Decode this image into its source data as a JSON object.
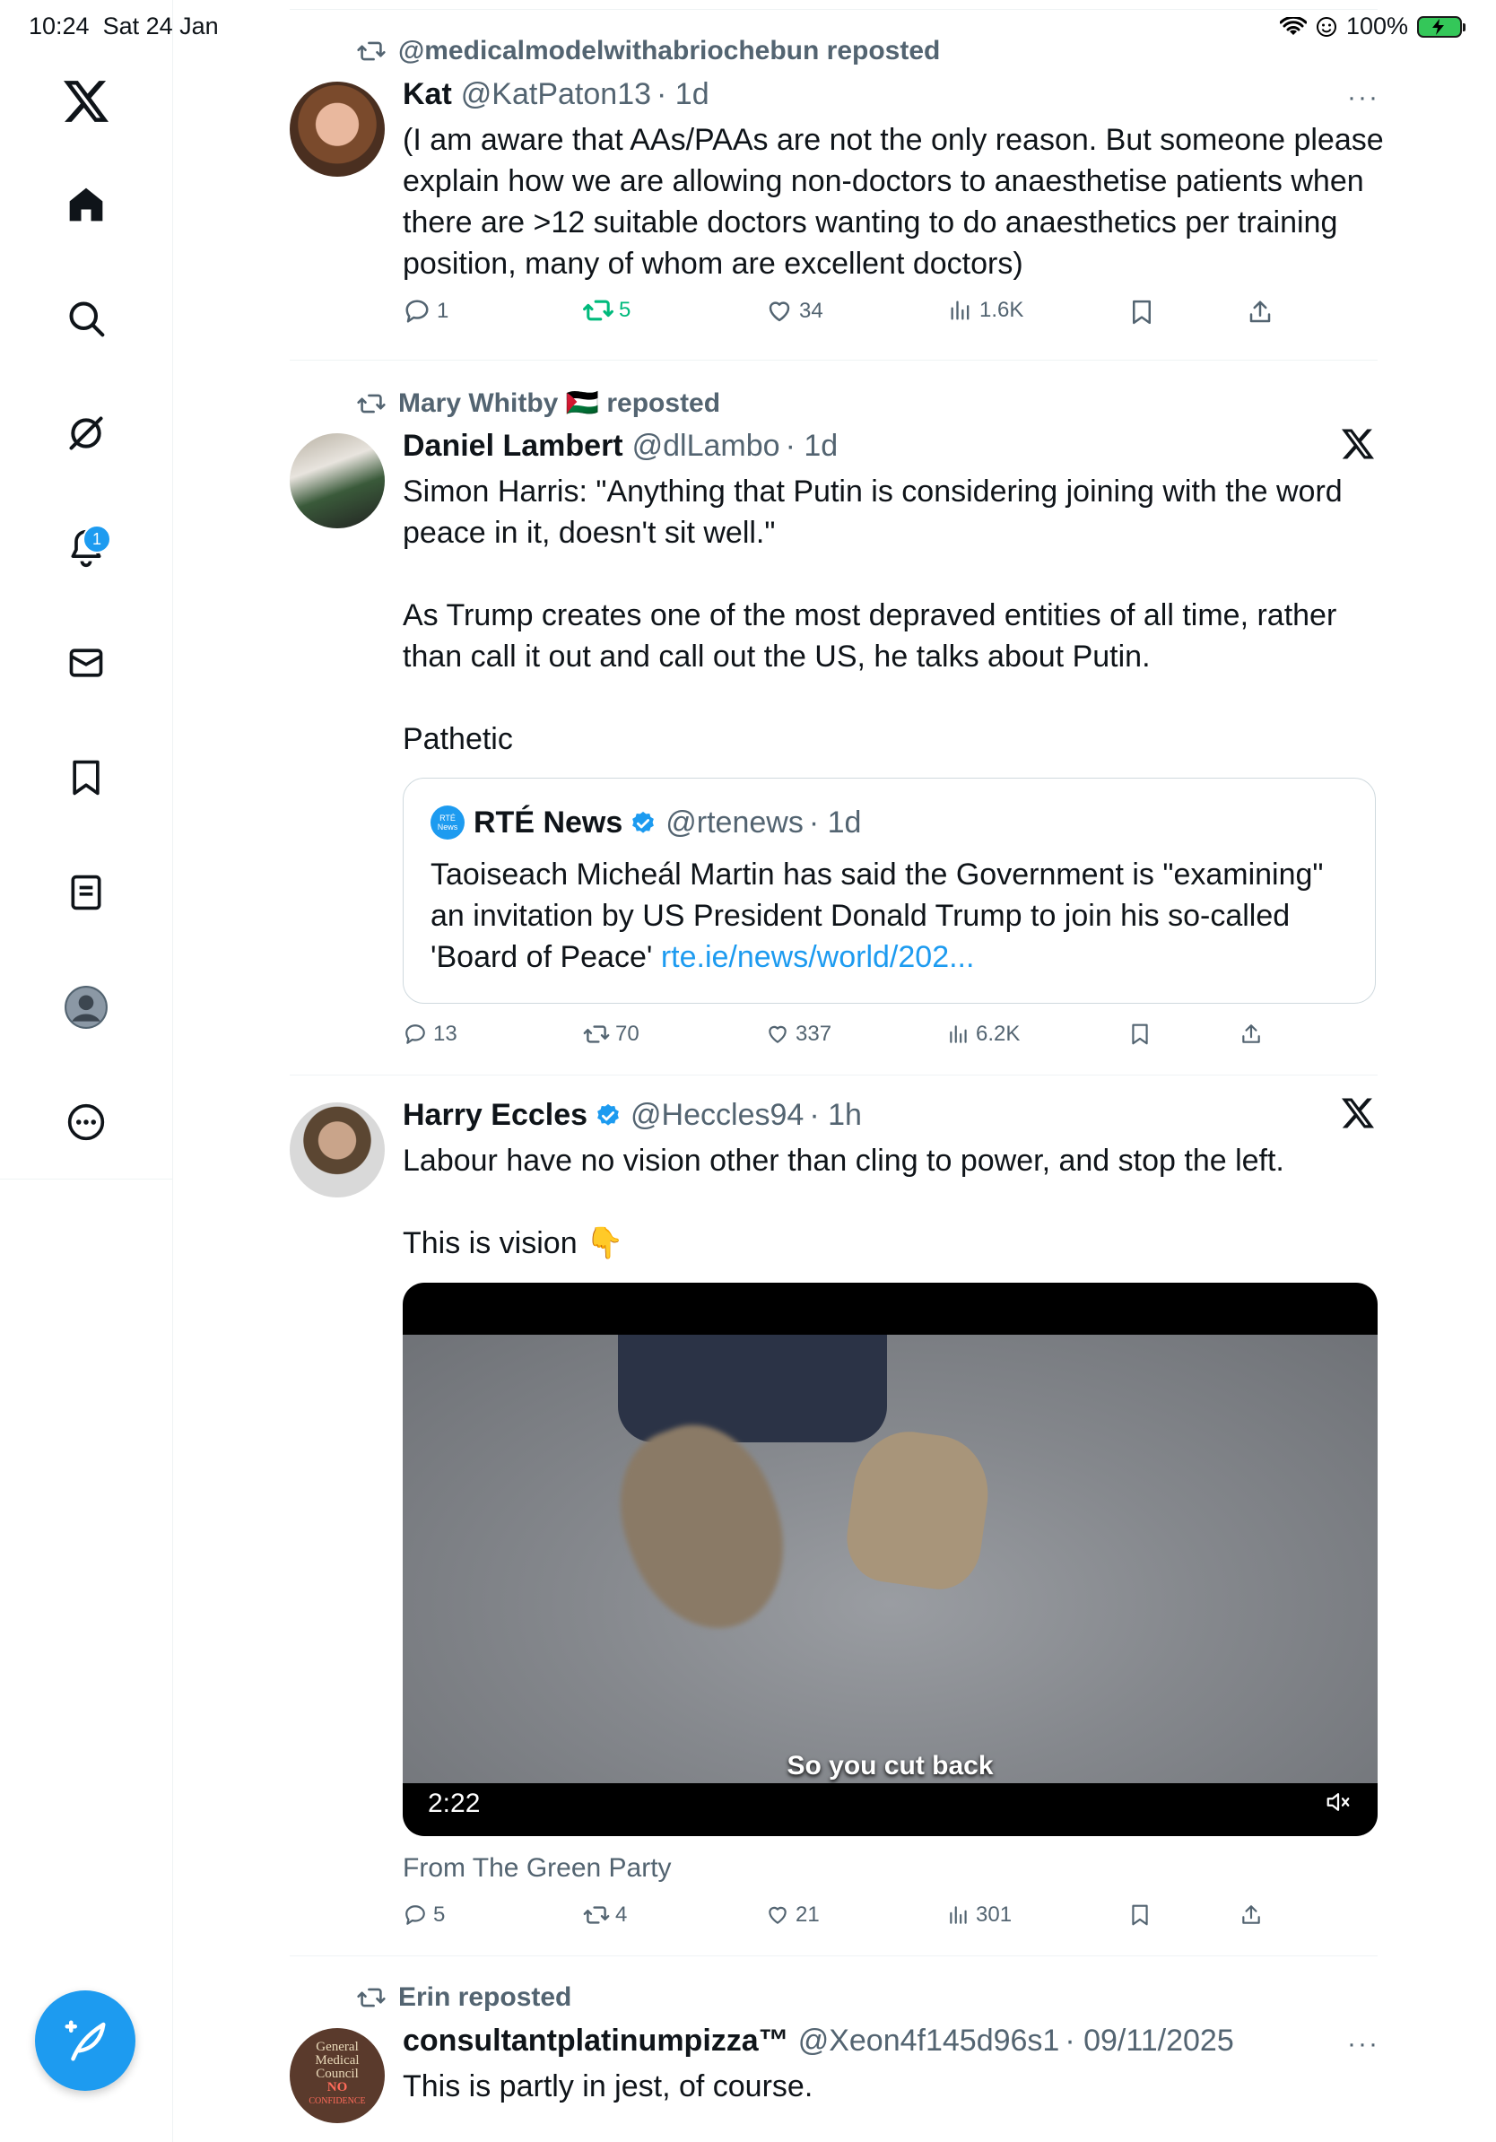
{
  "status": {
    "time": "10:24",
    "date": "Sat 24 Jan",
    "battery": "100%"
  },
  "sidebar": {
    "items": [
      {
        "icon": "x-logo-icon"
      },
      {
        "icon": "home-icon"
      },
      {
        "icon": "search-icon"
      },
      {
        "icon": "grok-icon"
      },
      {
        "icon": "bell-icon"
      },
      {
        "icon": "mail-icon"
      },
      {
        "icon": "bookmark-icon"
      },
      {
        "icon": "lists-icon"
      },
      {
        "icon": "profile-icon"
      },
      {
        "icon": "more-icon"
      }
    ],
    "notifications_badge": "1"
  },
  "tweets": [
    {
      "reposted_by": "@medicalmodelwithabriochebun reposted",
      "name": "Kat",
      "handle": "@KatPaton13",
      "time": "· 1d",
      "text": "(I am aware that AAs/PAAs are not the only reason. But someone please explain how we are allowing non-doctors to anaesthetise patients when there are >12 suitable doctors wanting to do anaesthetics per training position, many of whom are excellent doctors)",
      "replies": "1",
      "reposts": "5",
      "likes": "34",
      "views": "1.6K"
    },
    {
      "reposted_by": "Mary Whitby 🇵🇸 reposted",
      "name": "Daniel Lambert",
      "handle": "@dlLambo",
      "time": "· 1d",
      "text_p1": "Simon Harris: \"Anything that Putin is considering joining with the word peace in it, doesn't sit well.\"",
      "text_p2": "As Trump creates one of the most depraved entities of all time, rather than call it out and call out the US, he talks about Putin.",
      "text_p3": "Pathetic",
      "quote": {
        "name": "RTÉ News",
        "handle": "@rtenews",
        "time": "· 1d",
        "avatar_text": "RTÉ News",
        "text": "Taoiseach Micheál Martin has said the Government is \"examining\" an invitation by US President Donald Trump to join his so-called 'Board of Peace'",
        "link": "rte.ie/news/world/202..."
      },
      "replies": "13",
      "reposts": "70",
      "likes": "337",
      "views": "6.2K"
    },
    {
      "name": "Harry Eccles",
      "handle": "@Heccles94",
      "time": "· 1h",
      "text_p1": "Labour have no vision other than cling to power, and stop the left.",
      "text_p2": "This is vision 👇",
      "video": {
        "caption": "So you cut back",
        "duration": "2:22"
      },
      "source": "From The Green Party",
      "replies": "5",
      "reposts": "4",
      "likes": "21",
      "views": "301"
    },
    {
      "reposted_by": "Erin reposted",
      "name": "consultantplatinumpizza™",
      "handle": "@Xeon4f145d96s1",
      "time": "· 09/11/2025",
      "text": "This is partly in jest, of course.",
      "avatar_lines": [
        "General",
        "Medical",
        "Council",
        "NO",
        "CONFIDENCE"
      ]
    }
  ],
  "colors": {
    "accent": "#1d9bf0",
    "repost_active": "#00ba7c",
    "muted": "#536471"
  }
}
